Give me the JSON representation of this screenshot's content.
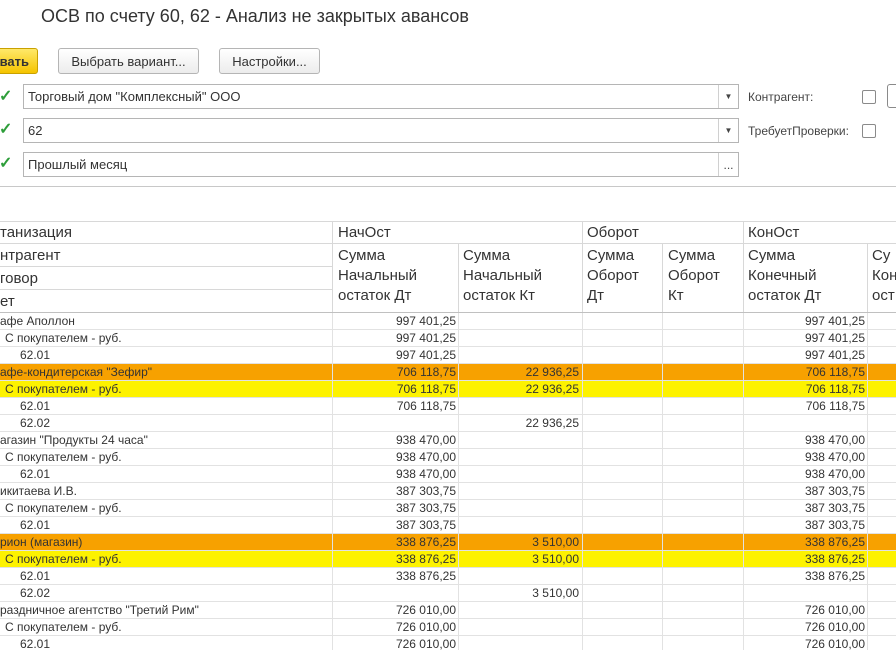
{
  "title": "ОСВ по счету 60, 62 - Анализ не закрытых авансов",
  "toolbar": {
    "generate_label": "вать",
    "variant_label": "Выбрать вариант...",
    "settings_label": "Настройки..."
  },
  "filters": [
    {
      "value": "Торговый дом \"Комплексный\" ООО",
      "button": "▾"
    },
    {
      "value": "62",
      "button": "▾"
    },
    {
      "value": "Прошлый месяц",
      "button": "..."
    }
  ],
  "side_options": {
    "counterparty_label": "Контрагент:",
    "requires_check_label": "ТребуетПроверки:"
  },
  "header": {
    "row_groups": [
      "танизация",
      "нтрагент",
      "говор",
      "ет"
    ],
    "col_groups": [
      "НачОст",
      "Оборот",
      "КонОст"
    ],
    "columns": [
      [
        "Сумма",
        "Начальный",
        "остаток Дт"
      ],
      [
        "Сумма",
        "Начальный",
        "остаток Кт"
      ],
      [
        "Сумма",
        "Оборот",
        "Дт"
      ],
      [
        "Сумма",
        "Оборот",
        "Кт"
      ],
      [
        "Сумма",
        "Конечный",
        "остаток Дт"
      ],
      [
        "Су",
        "Кон",
        "ост"
      ]
    ]
  },
  "rows": [
    {
      "label": "афе Аполлон",
      "indent": 0,
      "style": "",
      "nach_dt": "997 401,25",
      "nach_kt": "",
      "kon_dt": "997 401,25"
    },
    {
      "label": "С покупателем - руб.",
      "indent": 1,
      "style": "",
      "nach_dt": "997 401,25",
      "nach_kt": "",
      "kon_dt": "997 401,25"
    },
    {
      "label": "62.01",
      "indent": 2,
      "style": "",
      "nach_dt": "997 401,25",
      "nach_kt": "",
      "kon_dt": "997 401,25"
    },
    {
      "label": "афе-кондитерская \"Зефир\"",
      "indent": 0,
      "style": "orange",
      "nach_dt": "706 118,75",
      "nach_kt": "22 936,25",
      "kon_dt": "706 118,75"
    },
    {
      "label": "С покупателем - руб.",
      "indent": 1,
      "style": "yellow",
      "nach_dt": "706 118,75",
      "nach_kt": "22 936,25",
      "kon_dt": "706 118,75"
    },
    {
      "label": "62.01",
      "indent": 2,
      "style": "",
      "nach_dt": "706 118,75",
      "nach_kt": "",
      "kon_dt": "706 118,75"
    },
    {
      "label": "62.02",
      "indent": 2,
      "style": "",
      "nach_dt": "",
      "nach_kt": "22 936,25",
      "kon_dt": ""
    },
    {
      "label": "агазин \"Продукты 24 часа\"",
      "indent": 0,
      "style": "",
      "nach_dt": "938 470,00",
      "nach_kt": "",
      "kon_dt": "938 470,00"
    },
    {
      "label": "С покупателем - руб.",
      "indent": 1,
      "style": "",
      "nach_dt": "938 470,00",
      "nach_kt": "",
      "kon_dt": "938 470,00"
    },
    {
      "label": "62.01",
      "indent": 2,
      "style": "",
      "nach_dt": "938 470,00",
      "nach_kt": "",
      "kon_dt": "938 470,00"
    },
    {
      "label": "икитаева И.В.",
      "indent": 0,
      "style": "",
      "nach_dt": "387 303,75",
      "nach_kt": "",
      "kon_dt": "387 303,75"
    },
    {
      "label": "С покупателем - руб.",
      "indent": 1,
      "style": "",
      "nach_dt": "387 303,75",
      "nach_kt": "",
      "kon_dt": "387 303,75"
    },
    {
      "label": "62.01",
      "indent": 2,
      "style": "",
      "nach_dt": "387 303,75",
      "nach_kt": "",
      "kon_dt": "387 303,75"
    },
    {
      "label": "рион (магазин)",
      "indent": 0,
      "style": "orange",
      "nach_dt": "338 876,25",
      "nach_kt": "3 510,00",
      "kon_dt": "338 876,25"
    },
    {
      "label": "С покупателем - руб.",
      "indent": 1,
      "style": "yellow",
      "nach_dt": "338 876,25",
      "nach_kt": "3 510,00",
      "kon_dt": "338 876,25"
    },
    {
      "label": "62.01",
      "indent": 2,
      "style": "",
      "nach_dt": "338 876,25",
      "nach_kt": "",
      "kon_dt": "338 876,25"
    },
    {
      "label": "62.02",
      "indent": 2,
      "style": "",
      "nach_dt": "",
      "nach_kt": "3 510,00",
      "kon_dt": ""
    },
    {
      "label": "раздничное агентство \"Третий Рим\"",
      "indent": 0,
      "style": "",
      "nach_dt": "726 010,00",
      "nach_kt": "",
      "kon_dt": "726 010,00"
    },
    {
      "label": "С покупателем - руб.",
      "indent": 1,
      "style": "",
      "nach_dt": "726 010,00",
      "nach_kt": "",
      "kon_dt": "726 010,00"
    },
    {
      "label": "62.01",
      "indent": 2,
      "style": "",
      "nach_dt": "726 010,00",
      "nach_kt": "",
      "kon_dt": "726 010,00"
    }
  ]
}
